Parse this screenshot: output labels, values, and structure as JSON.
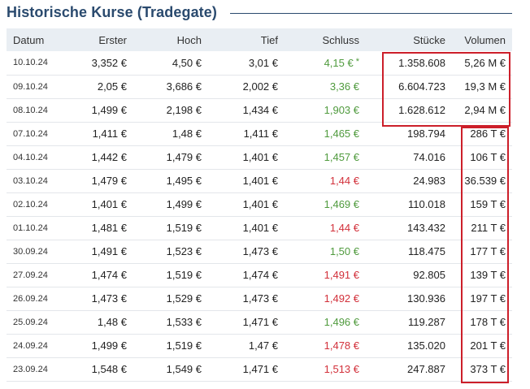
{
  "section": {
    "title": "Historische Kurse (Tradegate)"
  },
  "table": {
    "columns": [
      "Datum",
      "Erster",
      "Hoch",
      "Tief",
      "Schluss",
      "Stücke",
      "Volumen"
    ],
    "rows": [
      {
        "datum": "10.10.24",
        "erster": "3,352 €",
        "hoch": "4,50 €",
        "tief": "3,01 €",
        "schluss": "4,15 €",
        "trend": "up",
        "marker": "*",
        "stuecke": "1.358.608",
        "volumen": "5,26 M €"
      },
      {
        "datum": "09.10.24",
        "erster": "2,05 €",
        "hoch": "3,686 €",
        "tief": "2,002 €",
        "schluss": "3,36 €",
        "trend": "up",
        "marker": "",
        "stuecke": "6.604.723",
        "volumen": "19,3 M €"
      },
      {
        "datum": "08.10.24",
        "erster": "1,499 €",
        "hoch": "2,198 €",
        "tief": "1,434 €",
        "schluss": "1,903 €",
        "trend": "up",
        "marker": "",
        "stuecke": "1.628.612",
        "volumen": "2,94 M €"
      },
      {
        "datum": "07.10.24",
        "erster": "1,411 €",
        "hoch": "1,48 €",
        "tief": "1,411 €",
        "schluss": "1,465 €",
        "trend": "up",
        "marker": "",
        "stuecke": "198.794",
        "volumen": "286 T €"
      },
      {
        "datum": "04.10.24",
        "erster": "1,442 €",
        "hoch": "1,479 €",
        "tief": "1,401 €",
        "schluss": "1,457 €",
        "trend": "up",
        "marker": "",
        "stuecke": "74.016",
        "volumen": "106 T €"
      },
      {
        "datum": "03.10.24",
        "erster": "1,479 €",
        "hoch": "1,495 €",
        "tief": "1,401 €",
        "schluss": "1,44 €",
        "trend": "down",
        "marker": "",
        "stuecke": "24.983",
        "volumen": "36.539 €"
      },
      {
        "datum": "02.10.24",
        "erster": "1,401 €",
        "hoch": "1,499 €",
        "tief": "1,401 €",
        "schluss": "1,469 €",
        "trend": "up",
        "marker": "",
        "stuecke": "110.018",
        "volumen": "159 T €"
      },
      {
        "datum": "01.10.24",
        "erster": "1,481 €",
        "hoch": "1,519 €",
        "tief": "1,401 €",
        "schluss": "1,44 €",
        "trend": "down",
        "marker": "",
        "stuecke": "143.432",
        "volumen": "211 T €"
      },
      {
        "datum": "30.09.24",
        "erster": "1,491 €",
        "hoch": "1,523 €",
        "tief": "1,473 €",
        "schluss": "1,50 €",
        "trend": "up",
        "marker": "",
        "stuecke": "118.475",
        "volumen": "177 T €"
      },
      {
        "datum": "27.09.24",
        "erster": "1,474 €",
        "hoch": "1,519 €",
        "tief": "1,474 €",
        "schluss": "1,491 €",
        "trend": "down",
        "marker": "",
        "stuecke": "92.805",
        "volumen": "139 T €"
      },
      {
        "datum": "26.09.24",
        "erster": "1,473 €",
        "hoch": "1,529 €",
        "tief": "1,473 €",
        "schluss": "1,492 €",
        "trend": "down",
        "marker": "",
        "stuecke": "130.936",
        "volumen": "197 T €"
      },
      {
        "datum": "25.09.24",
        "erster": "1,48 €",
        "hoch": "1,533 €",
        "tief": "1,471 €",
        "schluss": "1,496 €",
        "trend": "up",
        "marker": "",
        "stuecke": "119.287",
        "volumen": "178 T €"
      },
      {
        "datum": "24.09.24",
        "erster": "1,499 €",
        "hoch": "1,519 €",
        "tief": "1,47 €",
        "schluss": "1,478 €",
        "trend": "down",
        "marker": "",
        "stuecke": "135.020",
        "volumen": "201 T €"
      },
      {
        "datum": "23.09.24",
        "erster": "1,548 €",
        "hoch": "1,549 €",
        "tief": "1,471 €",
        "schluss": "1,513 €",
        "trend": "down",
        "marker": "",
        "stuecke": "247.887",
        "volumen": "373 T €"
      }
    ]
  },
  "colors": {
    "title": "#2a4a6e",
    "header_bg": "#e9eef3",
    "up": "#4f9a3d",
    "down": "#d2303a",
    "highlight": "#cc1f2a"
  }
}
